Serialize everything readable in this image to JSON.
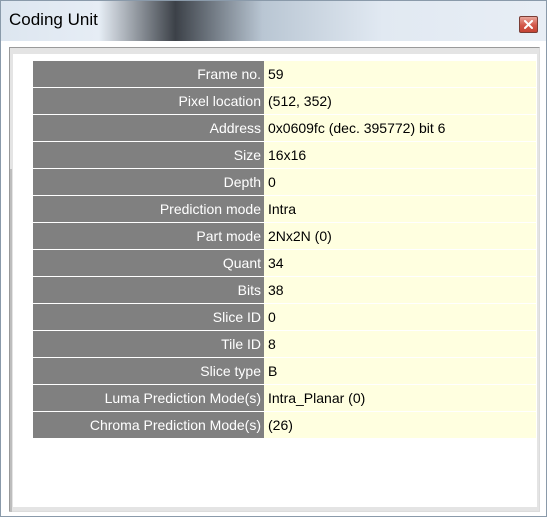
{
  "window": {
    "title": "Coding Unit"
  },
  "colors": {
    "label_bg": "#808080",
    "label_text": "#ffffff",
    "value_bg": "#ffffe0",
    "close_button": "#d3584a"
  },
  "icons": {
    "close": "close-icon"
  },
  "properties": [
    {
      "label": "Frame no.",
      "value": "59"
    },
    {
      "label": "Pixel location",
      "value": "(512, 352)"
    },
    {
      "label": "Address",
      "value": "0x0609fc (dec. 395772) bit 6"
    },
    {
      "label": "Size",
      "value": "16x16"
    },
    {
      "label": "Depth",
      "value": "0"
    },
    {
      "label": "Prediction mode",
      "value": "Intra"
    },
    {
      "label": "Part mode",
      "value": "2Nx2N (0)"
    },
    {
      "label": "Quant",
      "value": "34"
    },
    {
      "label": "Bits",
      "value": "38"
    },
    {
      "label": "Slice ID",
      "value": "0"
    },
    {
      "label": "Tile ID",
      "value": "8"
    },
    {
      "label": "Slice type",
      "value": "B"
    },
    {
      "label": "Luma Prediction Mode(s)",
      "value": "Intra_Planar (0)"
    },
    {
      "label": "Chroma Prediction Mode(s)",
      "value": "(26)"
    }
  ]
}
